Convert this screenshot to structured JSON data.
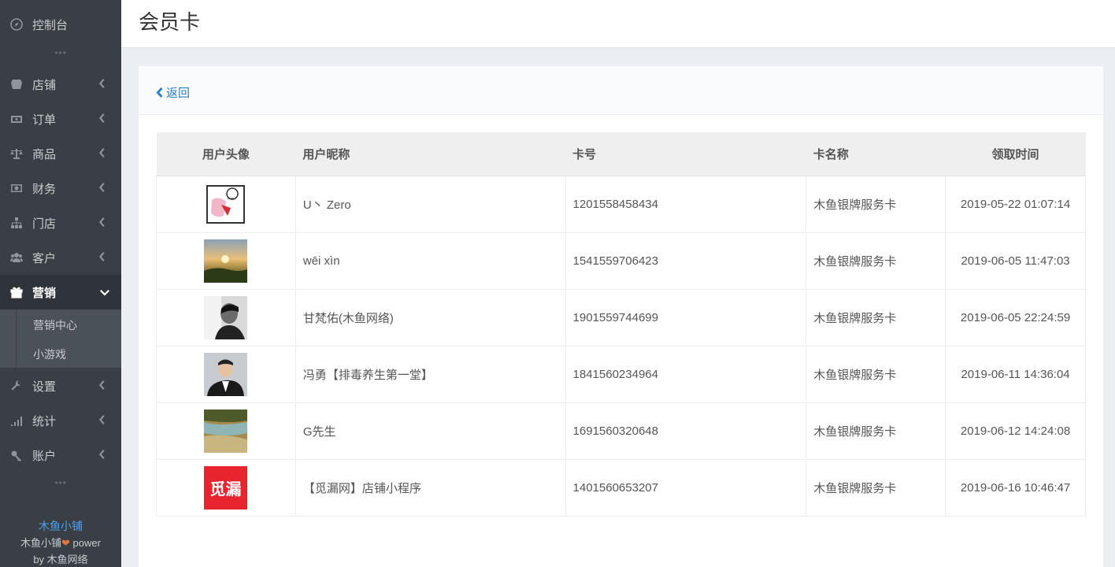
{
  "sidebar": {
    "items": [
      {
        "label": "控制台",
        "icon": "compass-icon"
      },
      {
        "label": "店铺",
        "icon": "store-icon"
      },
      {
        "label": "订单",
        "icon": "money-icon"
      },
      {
        "label": "商品",
        "icon": "scale-icon"
      },
      {
        "label": "财务",
        "icon": "cash-icon"
      },
      {
        "label": "门店",
        "icon": "sitemap-icon"
      },
      {
        "label": "客户",
        "icon": "users-icon"
      },
      {
        "label": "营销",
        "icon": "gift-icon"
      },
      {
        "label": "设置",
        "icon": "wrench-icon"
      },
      {
        "label": "统计",
        "icon": "signal-icon"
      },
      {
        "label": "账户",
        "icon": "key-icon"
      }
    ],
    "submenu": [
      "营销中心",
      "小游戏"
    ],
    "dots": "•••",
    "footer": {
      "brand": "木鱼小铺",
      "line2_prefix": "木鱼小铺",
      "line2_suffix": " power",
      "line3": "by 木鱼网络"
    }
  },
  "header": {
    "title": "会员卡"
  },
  "panel": {
    "back_label": "返回"
  },
  "table": {
    "columns": [
      "用户头像",
      "用户昵称",
      "卡号",
      "卡名称",
      "领取时间"
    ],
    "rows": [
      {
        "nickname": "U丶 Zero",
        "card_no": "1201558458434",
        "card_name": "木鱼银牌服务卡",
        "time": "2019-05-22 01:07:14",
        "avatar": "cartoon"
      },
      {
        "nickname": "wēi xìn",
        "card_no": "1541559706423",
        "card_name": "木鱼银牌服务卡",
        "time": "2019-06-05 11:47:03",
        "avatar": "sunset"
      },
      {
        "nickname": "甘梵佑(木鱼网络)",
        "card_no": "1901559744699",
        "card_name": "木鱼银牌服务卡",
        "time": "2019-06-05 22:24:59",
        "avatar": "bw-portrait"
      },
      {
        "nickname": "冯勇【排毒养生第一堂】",
        "card_no": "1841560234964",
        "card_name": "木鱼银牌服务卡",
        "time": "2019-06-11 14:36:04",
        "avatar": "suit-portrait"
      },
      {
        "nickname": "G先生",
        "card_no": "1691560320648",
        "card_name": "木鱼银牌服务卡",
        "time": "2019-06-12 14:24:08",
        "avatar": "landscape"
      },
      {
        "nickname": "【觅漏网】店铺小程序",
        "card_no": "1401560653207",
        "card_name": "木鱼银牌服务卡",
        "time": "2019-06-16 10:46:47",
        "avatar": "logo",
        "avatar_text": "觅漏"
      }
    ]
  }
}
